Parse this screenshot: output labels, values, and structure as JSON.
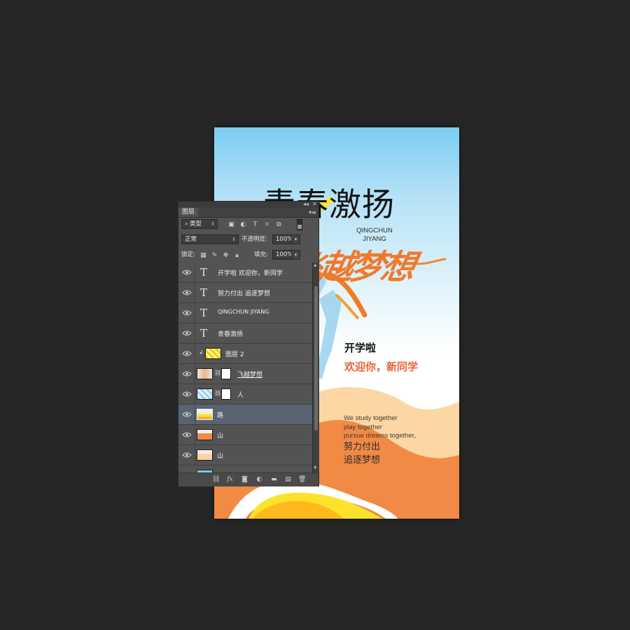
{
  "poster": {
    "title": "青春激扬",
    "subtitle_line1": "QINGCHUN",
    "subtitle_line2": "JIYANG",
    "calligraphy": "飞越梦想",
    "kaixue": "开学啦",
    "welcome": "欢迎你，新同学",
    "en_lines": [
      "We study together",
      "play together",
      "pursue dreams together,"
    ],
    "cn_lines": [
      "努力付出",
      "追逐梦想"
    ],
    "colors": {
      "sky": "#7ccdf2",
      "orange": "#f0884a",
      "light_orange": "#fbd3a0",
      "yellow": "#fde428",
      "figure": "#9fd3ee"
    }
  },
  "panel": {
    "tab_label": "图层",
    "filter_label": "类型",
    "blend_mode": "正常",
    "opacity_label": "不透明度:",
    "opacity_value": "100%",
    "lock_label": "锁定:",
    "fill_label": "填充:",
    "fill_value": "100%",
    "layers": [
      {
        "name": "开学啦 欢迎你，新同学",
        "type": "text"
      },
      {
        "name": "努力付出 追逐梦想",
        "type": "text"
      },
      {
        "name": "QINGCHUN JIYANG",
        "type": "text"
      },
      {
        "name": "青春激扬",
        "type": "text"
      },
      {
        "name": "图层 2",
        "type": "image",
        "clipped": true
      },
      {
        "name": "飞越梦想",
        "type": "image",
        "masked": true
      },
      {
        "name": "人",
        "type": "image",
        "masked": true
      },
      {
        "name": "路",
        "type": "image",
        "selected": true
      },
      {
        "name": "山",
        "type": "image"
      },
      {
        "name": "山",
        "type": "image"
      }
    ],
    "filter_icons": [
      "image-filter-icon",
      "adjustment-filter-icon",
      "type-filter-icon",
      "shape-filter-icon",
      "smart-object-filter-icon"
    ],
    "lock_icons": [
      "lock-transparent-icon",
      "lock-image-icon",
      "lock-position-icon",
      "lock-all-icon"
    ],
    "bottom_icons": [
      "link-icon",
      "fx-icon",
      "mask-icon",
      "adjustment-icon",
      "group-icon",
      "new-layer-icon",
      "delete-icon"
    ]
  }
}
